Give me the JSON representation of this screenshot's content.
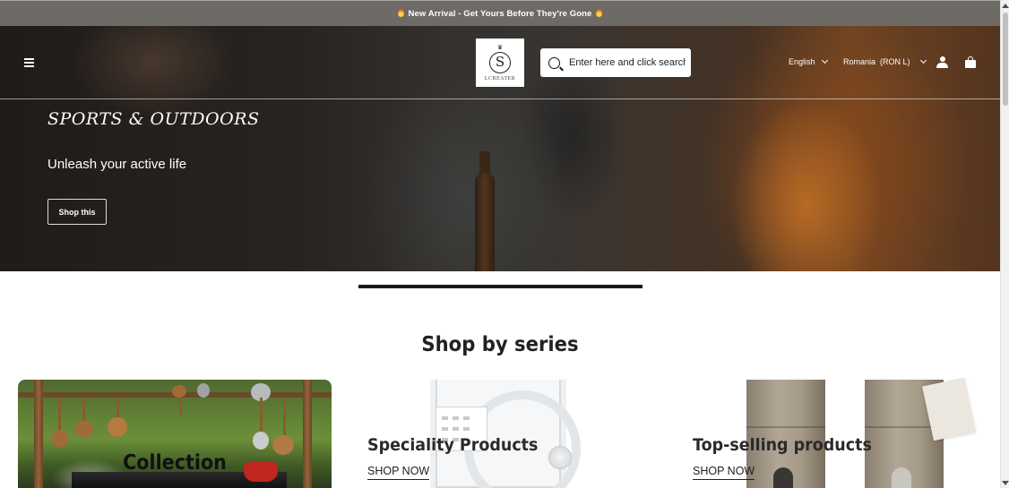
{
  "announcement": {
    "text": "New Arrival - Get Yours Before They're Gone"
  },
  "header": {
    "logo": {
      "monogram": "S",
      "name": "LCREATER"
    },
    "search": {
      "placeholder": "Enter here and click search"
    },
    "language": "English",
    "region": {
      "country": "Romania",
      "currency": "(RON L)"
    },
    "icons": [
      "menu-icon",
      "search-icon",
      "user-icon",
      "bag-icon",
      "chevron-down-icon"
    ]
  },
  "hero": {
    "title": "SPORTS & OUTDOORS",
    "subtitle": "Unleash your active life",
    "button_label": "Shop this"
  },
  "series": {
    "title": "Shop by series",
    "cards": [
      {
        "label": "Collection"
      },
      {
        "label": "Speciality Products",
        "cta": "SHOP NOW"
      },
      {
        "label": "Top-selling products",
        "cta": "SHOP NOW"
      }
    ]
  },
  "colors": {
    "announcement_bg": "#6e6a66",
    "text_dark": "#222222",
    "accent_orange": "#c97528"
  }
}
